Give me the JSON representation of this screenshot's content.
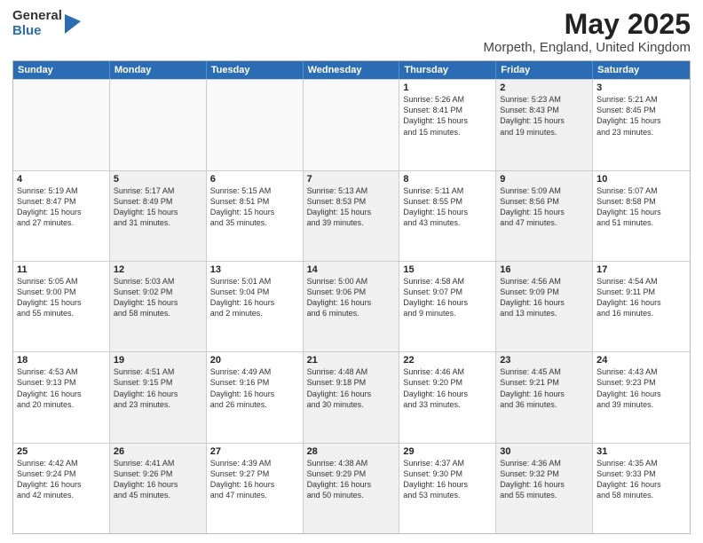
{
  "logo": {
    "general": "General",
    "blue": "Blue"
  },
  "title": "May 2025",
  "subtitle": "Morpeth, England, United Kingdom",
  "headers": [
    "Sunday",
    "Monday",
    "Tuesday",
    "Wednesday",
    "Thursday",
    "Friday",
    "Saturday"
  ],
  "rows": [
    [
      {
        "day": "",
        "text": "",
        "empty": true
      },
      {
        "day": "",
        "text": "",
        "empty": true
      },
      {
        "day": "",
        "text": "",
        "empty": true
      },
      {
        "day": "",
        "text": "",
        "empty": true
      },
      {
        "day": "1",
        "text": "Sunrise: 5:26 AM\nSunset: 8:41 PM\nDaylight: 15 hours\nand 15 minutes."
      },
      {
        "day": "2",
        "text": "Sunrise: 5:23 AM\nSunset: 8:43 PM\nDaylight: 15 hours\nand 19 minutes.",
        "shaded": true
      },
      {
        "day": "3",
        "text": "Sunrise: 5:21 AM\nSunset: 8:45 PM\nDaylight: 15 hours\nand 23 minutes."
      }
    ],
    [
      {
        "day": "4",
        "text": "Sunrise: 5:19 AM\nSunset: 8:47 PM\nDaylight: 15 hours\nand 27 minutes."
      },
      {
        "day": "5",
        "text": "Sunrise: 5:17 AM\nSunset: 8:49 PM\nDaylight: 15 hours\nand 31 minutes.",
        "shaded": true
      },
      {
        "day": "6",
        "text": "Sunrise: 5:15 AM\nSunset: 8:51 PM\nDaylight: 15 hours\nand 35 minutes."
      },
      {
        "day": "7",
        "text": "Sunrise: 5:13 AM\nSunset: 8:53 PM\nDaylight: 15 hours\nand 39 minutes.",
        "shaded": true
      },
      {
        "day": "8",
        "text": "Sunrise: 5:11 AM\nSunset: 8:55 PM\nDaylight: 15 hours\nand 43 minutes."
      },
      {
        "day": "9",
        "text": "Sunrise: 5:09 AM\nSunset: 8:56 PM\nDaylight: 15 hours\nand 47 minutes.",
        "shaded": true
      },
      {
        "day": "10",
        "text": "Sunrise: 5:07 AM\nSunset: 8:58 PM\nDaylight: 15 hours\nand 51 minutes."
      }
    ],
    [
      {
        "day": "11",
        "text": "Sunrise: 5:05 AM\nSunset: 9:00 PM\nDaylight: 15 hours\nand 55 minutes."
      },
      {
        "day": "12",
        "text": "Sunrise: 5:03 AM\nSunset: 9:02 PM\nDaylight: 15 hours\nand 58 minutes.",
        "shaded": true
      },
      {
        "day": "13",
        "text": "Sunrise: 5:01 AM\nSunset: 9:04 PM\nDaylight: 16 hours\nand 2 minutes."
      },
      {
        "day": "14",
        "text": "Sunrise: 5:00 AM\nSunset: 9:06 PM\nDaylight: 16 hours\nand 6 minutes.",
        "shaded": true
      },
      {
        "day": "15",
        "text": "Sunrise: 4:58 AM\nSunset: 9:07 PM\nDaylight: 16 hours\nand 9 minutes."
      },
      {
        "day": "16",
        "text": "Sunrise: 4:56 AM\nSunset: 9:09 PM\nDaylight: 16 hours\nand 13 minutes.",
        "shaded": true
      },
      {
        "day": "17",
        "text": "Sunrise: 4:54 AM\nSunset: 9:11 PM\nDaylight: 16 hours\nand 16 minutes."
      }
    ],
    [
      {
        "day": "18",
        "text": "Sunrise: 4:53 AM\nSunset: 9:13 PM\nDaylight: 16 hours\nand 20 minutes."
      },
      {
        "day": "19",
        "text": "Sunrise: 4:51 AM\nSunset: 9:15 PM\nDaylight: 16 hours\nand 23 minutes.",
        "shaded": true
      },
      {
        "day": "20",
        "text": "Sunrise: 4:49 AM\nSunset: 9:16 PM\nDaylight: 16 hours\nand 26 minutes."
      },
      {
        "day": "21",
        "text": "Sunrise: 4:48 AM\nSunset: 9:18 PM\nDaylight: 16 hours\nand 30 minutes.",
        "shaded": true
      },
      {
        "day": "22",
        "text": "Sunrise: 4:46 AM\nSunset: 9:20 PM\nDaylight: 16 hours\nand 33 minutes."
      },
      {
        "day": "23",
        "text": "Sunrise: 4:45 AM\nSunset: 9:21 PM\nDaylight: 16 hours\nand 36 minutes.",
        "shaded": true
      },
      {
        "day": "24",
        "text": "Sunrise: 4:43 AM\nSunset: 9:23 PM\nDaylight: 16 hours\nand 39 minutes."
      }
    ],
    [
      {
        "day": "25",
        "text": "Sunrise: 4:42 AM\nSunset: 9:24 PM\nDaylight: 16 hours\nand 42 minutes."
      },
      {
        "day": "26",
        "text": "Sunrise: 4:41 AM\nSunset: 9:26 PM\nDaylight: 16 hours\nand 45 minutes.",
        "shaded": true
      },
      {
        "day": "27",
        "text": "Sunrise: 4:39 AM\nSunset: 9:27 PM\nDaylight: 16 hours\nand 47 minutes."
      },
      {
        "day": "28",
        "text": "Sunrise: 4:38 AM\nSunset: 9:29 PM\nDaylight: 16 hours\nand 50 minutes.",
        "shaded": true
      },
      {
        "day": "29",
        "text": "Sunrise: 4:37 AM\nSunset: 9:30 PM\nDaylight: 16 hours\nand 53 minutes."
      },
      {
        "day": "30",
        "text": "Sunrise: 4:36 AM\nSunset: 9:32 PM\nDaylight: 16 hours\nand 55 minutes.",
        "shaded": true
      },
      {
        "day": "31",
        "text": "Sunrise: 4:35 AM\nSunset: 9:33 PM\nDaylight: 16 hours\nand 58 minutes."
      }
    ]
  ]
}
